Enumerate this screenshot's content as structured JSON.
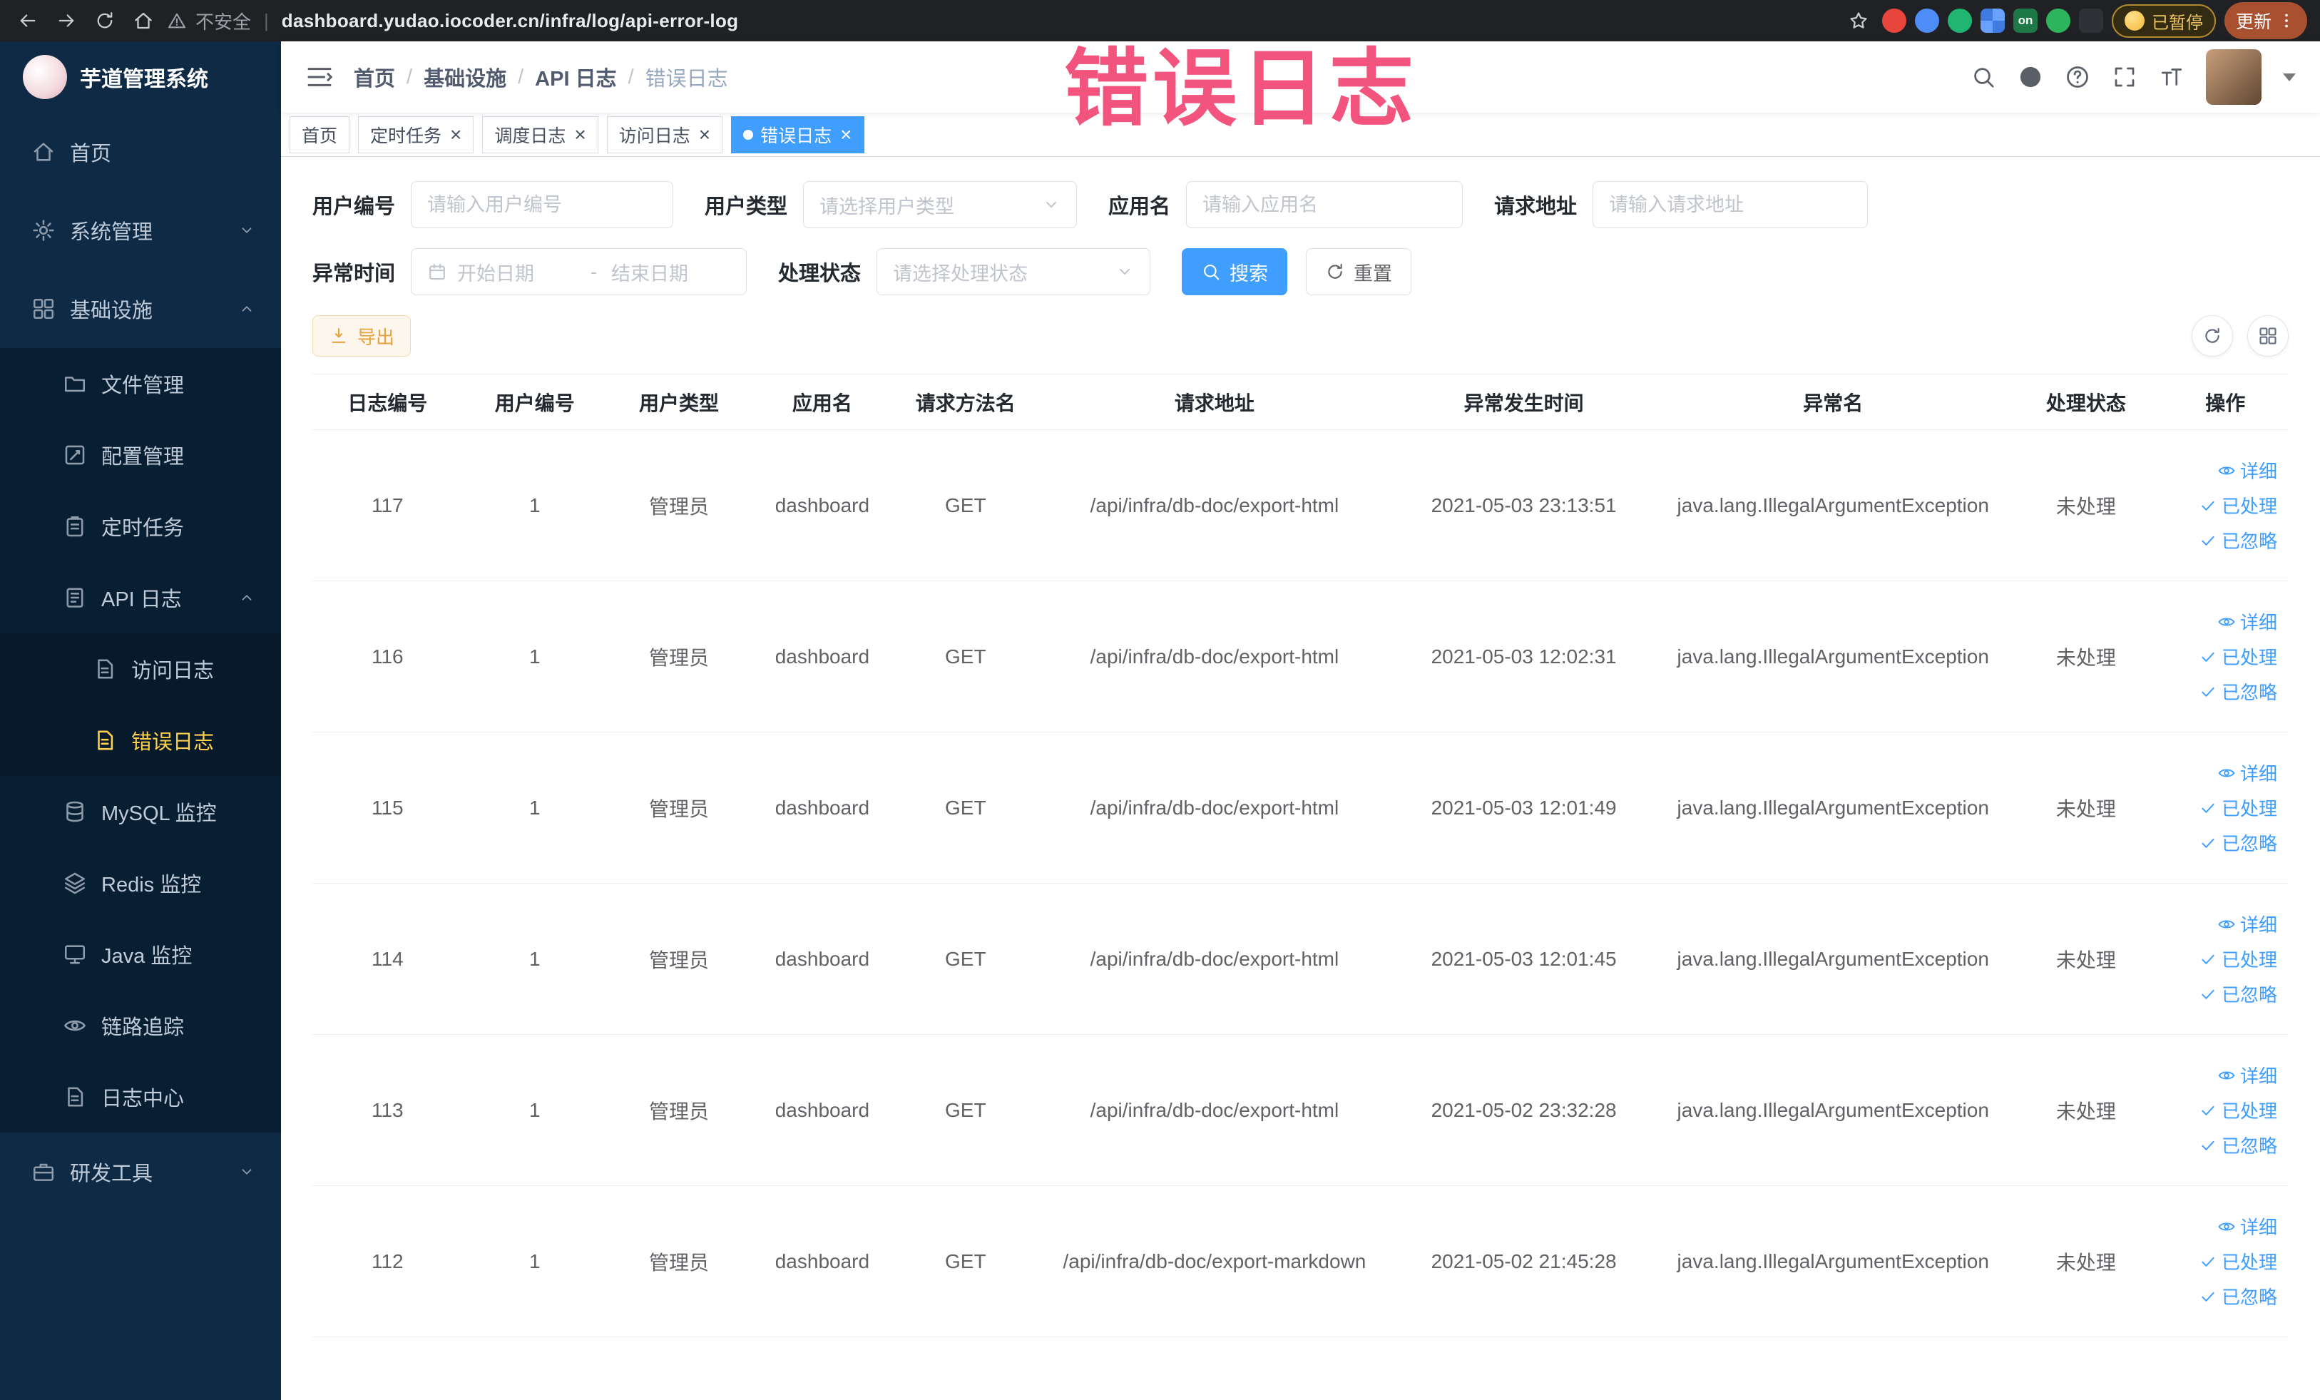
{
  "annotation": {
    "text": "错误日志"
  },
  "browser": {
    "warning_label": "不安全",
    "separator": "|",
    "url": "dashboard.yudao.iocoder.cn/infra/log/api-error-log",
    "extension_on_label": "on",
    "paused_badge": "已暂停",
    "update_label": "更新"
  },
  "sidebar": {
    "logo_title": "芋道管理系统",
    "items": [
      {
        "label": "首页",
        "level": 1,
        "icon": "home"
      },
      {
        "label": "系统管理",
        "level": 1,
        "icon": "gear",
        "chevron": "down"
      },
      {
        "label": "基础设施",
        "level": 1,
        "icon": "grid",
        "chevron": "up"
      },
      {
        "label": "文件管理",
        "level": 2,
        "icon": "folder"
      },
      {
        "label": "配置管理",
        "level": 2,
        "icon": "edit"
      },
      {
        "label": "定时任务",
        "level": 2,
        "icon": "clipboard"
      },
      {
        "label": "API 日志",
        "level": 2,
        "icon": "log",
        "chevron": "up"
      },
      {
        "label": "访问日志",
        "level": 3,
        "icon": "doc"
      },
      {
        "label": "错误日志",
        "level": 3,
        "icon": "doc",
        "active": true
      },
      {
        "label": "MySQL 监控",
        "level": 2,
        "icon": "database"
      },
      {
        "label": "Redis 监控",
        "level": 2,
        "icon": "layers"
      },
      {
        "label": "Java 监控",
        "level": 2,
        "icon": "monitor"
      },
      {
        "label": "链路追踪",
        "level": 2,
        "icon": "eye"
      },
      {
        "label": "日志中心",
        "level": 2,
        "icon": "doc"
      },
      {
        "label": "研发工具",
        "level": 1,
        "icon": "tools",
        "chevron": "down"
      }
    ]
  },
  "navbar": {
    "separator": "/",
    "breadcrumb": [
      {
        "label": "首页"
      },
      {
        "label": "基础设施"
      },
      {
        "label": "API 日志"
      },
      {
        "label": "错误日志",
        "current": true
      }
    ]
  },
  "tabs": [
    {
      "label": "首页",
      "closable": false,
      "active": false
    },
    {
      "label": "定时任务",
      "closable": true,
      "active": false
    },
    {
      "label": "调度日志",
      "closable": true,
      "active": false
    },
    {
      "label": "访问日志",
      "closable": true,
      "active": false
    },
    {
      "label": "错误日志",
      "closable": true,
      "active": true
    }
  ],
  "filters": {
    "user_id_label": "用户编号",
    "user_id_placeholder": "请输入用户编号",
    "user_type_label": "用户类型",
    "user_type_placeholder": "请选择用户类型",
    "app_name_label": "应用名",
    "app_name_placeholder": "请输入应用名",
    "request_url_label": "请求地址",
    "request_url_placeholder": "请输入请求地址",
    "exception_time_label": "异常时间",
    "start_placeholder": "开始日期",
    "range_separator": "-",
    "end_placeholder": "结束日期",
    "process_status_label": "处理状态",
    "process_status_placeholder": "请选择处理状态",
    "search_label": "搜索",
    "reset_label": "重置"
  },
  "toolbar": {
    "export_label": "导出"
  },
  "table": {
    "columns": [
      "日志编号",
      "用户编号",
      "用户类型",
      "应用名",
      "请求方法名",
      "请求地址",
      "异常发生时间",
      "异常名",
      "处理状态",
      "操作"
    ],
    "actions": [
      {
        "label": "详细",
        "icon": "eye"
      },
      {
        "label": "已处理",
        "icon": "check"
      },
      {
        "label": "已忽略",
        "icon": "check"
      }
    ],
    "rows": [
      {
        "id": "117",
        "user_id": "1",
        "user_type": "管理员",
        "app_name": "dashboard",
        "method": "GET",
        "url": "/api/infra/db-doc/export-html",
        "time": "2021-05-03 23:13:51",
        "exception": "java.lang.IllegalArgumentException",
        "status": "未处理"
      },
      {
        "id": "116",
        "user_id": "1",
        "user_type": "管理员",
        "app_name": "dashboard",
        "method": "GET",
        "url": "/api/infra/db-doc/export-html",
        "time": "2021-05-03 12:02:31",
        "exception": "java.lang.IllegalArgumentException",
        "status": "未处理"
      },
      {
        "id": "115",
        "user_id": "1",
        "user_type": "管理员",
        "app_name": "dashboard",
        "method": "GET",
        "url": "/api/infra/db-doc/export-html",
        "time": "2021-05-03 12:01:49",
        "exception": "java.lang.IllegalArgumentException",
        "status": "未处理"
      },
      {
        "id": "114",
        "user_id": "1",
        "user_type": "管理员",
        "app_name": "dashboard",
        "method": "GET",
        "url": "/api/infra/db-doc/export-html",
        "time": "2021-05-03 12:01:45",
        "exception": "java.lang.IllegalArgumentException",
        "status": "未处理"
      },
      {
        "id": "113",
        "user_id": "1",
        "user_type": "管理员",
        "app_name": "dashboard",
        "method": "GET",
        "url": "/api/infra/db-doc/export-html",
        "time": "2021-05-02 23:32:28",
        "exception": "java.lang.IllegalArgumentException",
        "status": "未处理"
      },
      {
        "id": "112",
        "user_id": "1",
        "user_type": "管理员",
        "app_name": "dashboard",
        "method": "GET",
        "url": "/api/infra/db-doc/export-markdown",
        "time": "2021-05-02 21:45:28",
        "exception": "java.lang.IllegalArgumentException",
        "status": "未处理"
      }
    ]
  }
}
